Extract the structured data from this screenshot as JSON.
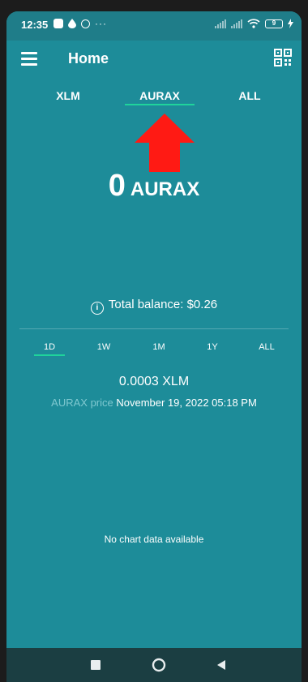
{
  "status_bar": {
    "time": "12:35",
    "more_dots": "···",
    "battery_level": "9"
  },
  "header": {
    "title": "Home",
    "menu_icon": "hamburger-menu-icon",
    "qr_icon": "qr-code-icon"
  },
  "tabs": [
    {
      "label": "XLM",
      "active": false
    },
    {
      "label": "AURAX",
      "active": true
    },
    {
      "label": "ALL",
      "active": false
    }
  ],
  "annotation": {
    "icon": "red-arrow-up-icon",
    "color": "#ff1a14"
  },
  "balance": {
    "amount": "0",
    "unit": "AURAX",
    "total_label": "Total balance: $0.26",
    "info_icon": "info-icon"
  },
  "periods": [
    {
      "label": "1D",
      "active": true
    },
    {
      "label": "1W",
      "active": false
    },
    {
      "label": "1M",
      "active": false
    },
    {
      "label": "1Y",
      "active": false
    },
    {
      "label": "ALL",
      "active": false
    }
  ],
  "price": {
    "value": "0.0003 XLM",
    "label": "AURAX price",
    "date": "November 19, 2022 05:18 PM"
  },
  "chart": {
    "empty_message": "No chart data available"
  },
  "colors": {
    "background": "#1d8c99",
    "accent": "#1fd49b",
    "nav_bar": "#1b3e42"
  }
}
